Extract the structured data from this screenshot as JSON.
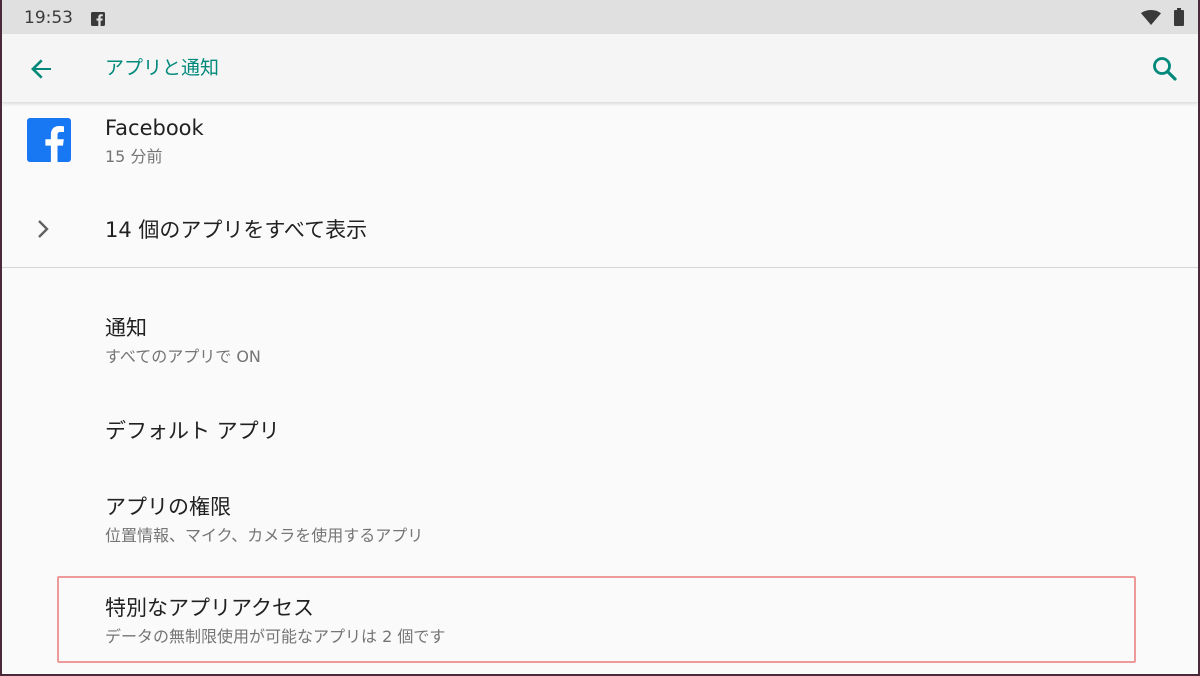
{
  "status_bar": {
    "time": "19:53",
    "notification_icon": "facebook-icon",
    "wifi_icon": "wifi-icon",
    "battery_icon": "battery-icon"
  },
  "app_bar": {
    "back_icon": "back-arrow-icon",
    "title": "アプリと通知",
    "search_icon": "search-icon"
  },
  "recent_apps": [
    {
      "name": "Facebook",
      "time": "15 分前",
      "icon": "facebook-app-icon"
    }
  ],
  "see_all": {
    "label": "14 個のアプリをすべて表示",
    "icon": "chevron-right-icon"
  },
  "settings": [
    {
      "title": "通知",
      "subtitle": "すべてのアプリで ON"
    },
    {
      "title": "デフォルト アプリ",
      "subtitle": ""
    },
    {
      "title": "アプリの権限",
      "subtitle": "位置情報、マイク、カメラを使用するアプリ"
    },
    {
      "title": "特別なアプリアクセス",
      "subtitle": "データの無制限使用が可能なアプリは 2 個です"
    }
  ],
  "colors": {
    "accent": "#00897b",
    "facebook_blue": "#1877f2",
    "highlight": "#ef9a9a"
  }
}
